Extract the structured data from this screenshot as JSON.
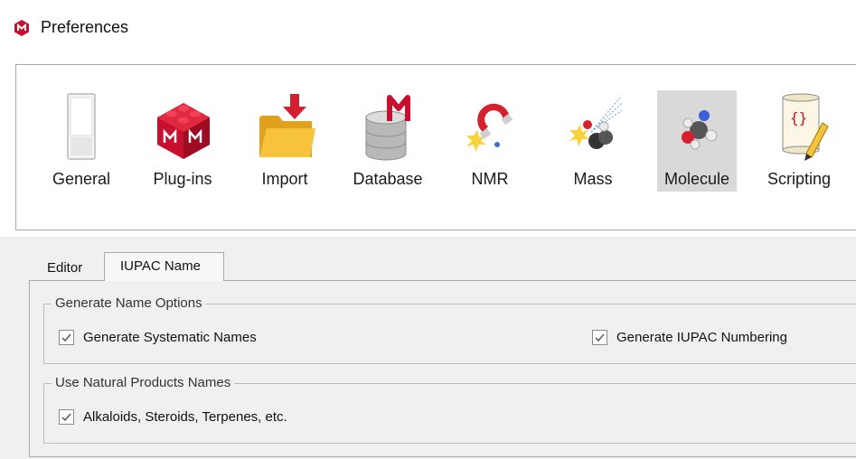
{
  "window": {
    "title": "Preferences",
    "icon": "app-logo-icon"
  },
  "toolbar": {
    "items": [
      {
        "label": "General",
        "icon": "general-switch-icon"
      },
      {
        "label": "Plug-ins",
        "icon": "plugin-block-icon"
      },
      {
        "label": "Import",
        "icon": "import-folder-icon"
      },
      {
        "label": "Database",
        "icon": "database-icon"
      },
      {
        "label": "NMR",
        "icon": "nmr-magnet-icon"
      },
      {
        "label": "Mass",
        "icon": "mass-spec-icon"
      },
      {
        "label": "Molecule",
        "icon": "molecule-icon",
        "active": true
      },
      {
        "label": "Scripting",
        "icon": "scripting-scroll-icon"
      }
    ]
  },
  "tabs": [
    {
      "label": "Editor",
      "selected": false
    },
    {
      "label": "IUPAC Name",
      "selected": true
    }
  ],
  "groups": {
    "generate": {
      "title": "Generate Name Options",
      "systematic": {
        "label": "Generate Systematic Names",
        "checked": true
      },
      "numbering": {
        "label": "Generate IUPAC Numbering",
        "checked": true
      }
    },
    "natural": {
      "title": "Use Natural Products Names",
      "alkaloids": {
        "label": "Alkaloids, Steroids, Terpenes, etc.",
        "checked": true
      }
    }
  },
  "colors": {
    "brand_red": "#c8102e",
    "active_item_bg": "#d9d9d9",
    "border": "#a9a9a9"
  }
}
